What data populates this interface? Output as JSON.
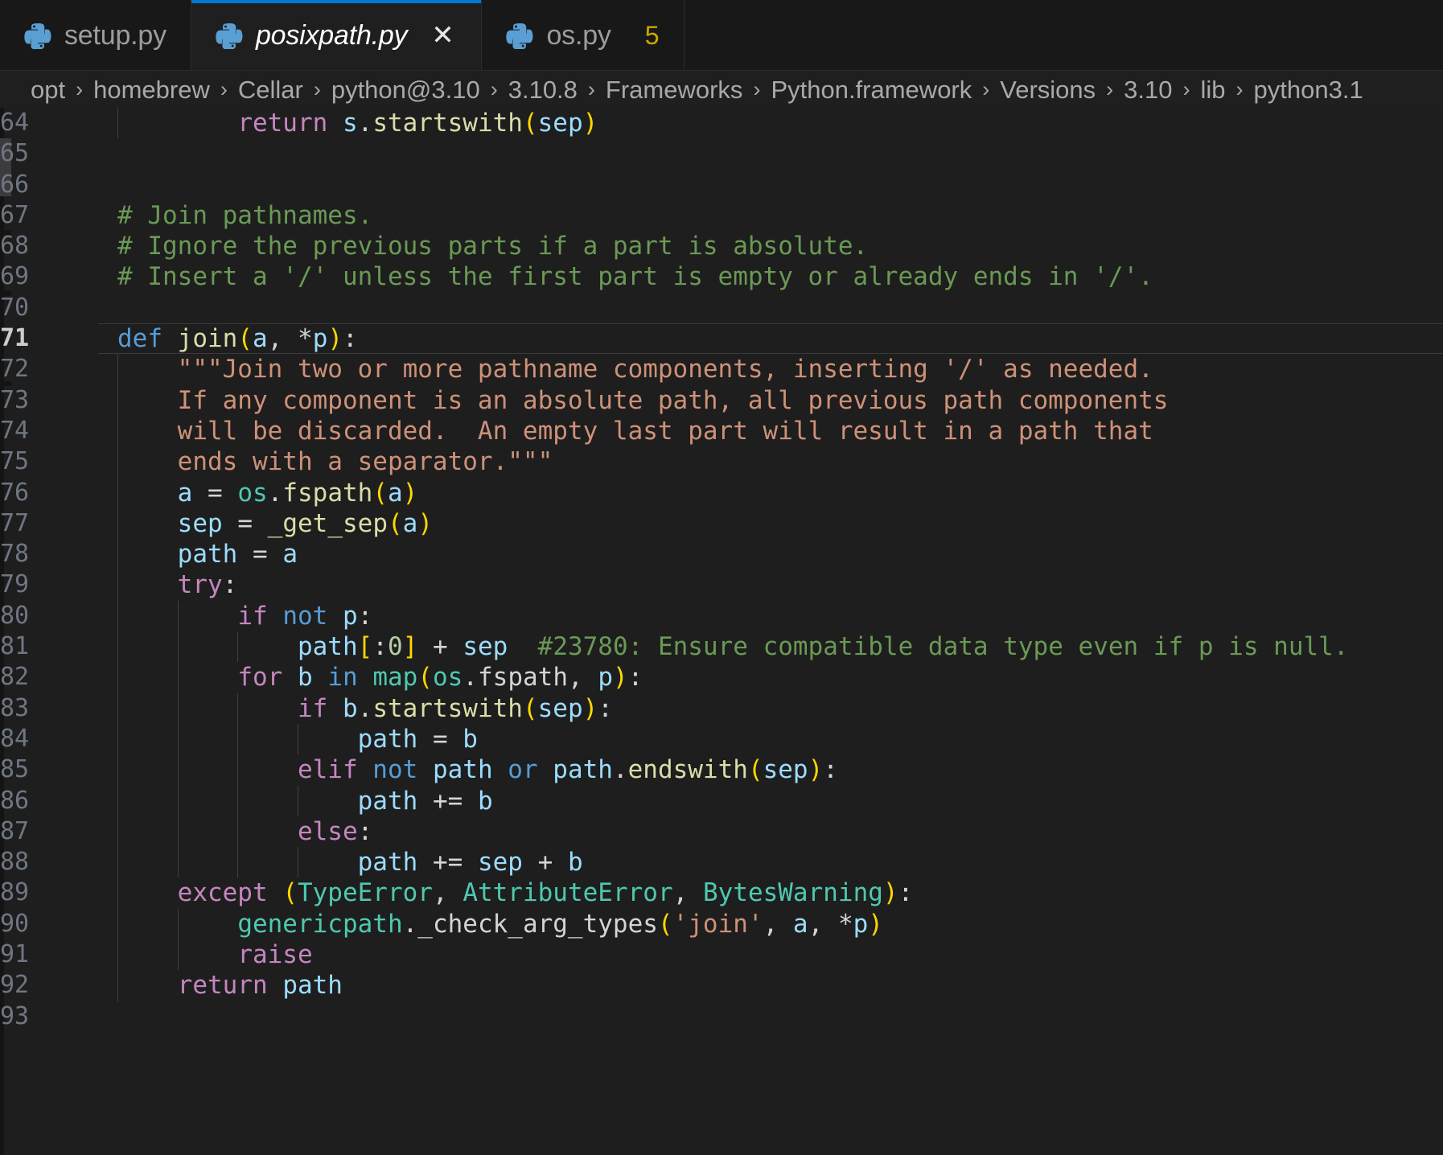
{
  "window": {
    "app": "vscode-editor",
    "background": "#1e1e1e"
  },
  "colors": {
    "accent": "#0078d4",
    "tab_active_bg": "#1f1f1f",
    "tab_inactive_bg": "#181818",
    "editor_bg": "#1e1e1e",
    "keyword_pink": "#c586c0",
    "keyword_blue": "#569cd6",
    "function_yellow": "#dcdcaa",
    "variable_blue": "#9cdcfe",
    "class_teal": "#4ec9b0",
    "string_salmon": "#ce9178",
    "comment_green": "#6a9955",
    "number_green": "#b5cea8",
    "bracket_gold": "#ffd700",
    "warning_amber": "#cca700",
    "linenum_grey": "#6e7681"
  },
  "tabs": [
    {
      "label": "setup.py",
      "icon": "python-file-icon",
      "state": "inactive",
      "badge": "",
      "closable": false,
      "warn": false
    },
    {
      "label": "posixpath.py",
      "icon": "python-file-icon",
      "state": "active",
      "badge": "",
      "closable": true,
      "warn": false
    },
    {
      "label": "os.py",
      "icon": "python-file-icon",
      "state": "inactive",
      "badge": "5",
      "closable": false,
      "warn": true
    }
  ],
  "breadcrumb": {
    "separator": "›",
    "items": [
      "opt",
      "homebrew",
      "Cellar",
      "python@3.10",
      "3.10.8",
      "Frameworks",
      "Python.framework",
      "Versions",
      "3.10",
      "lib",
      "python3.1"
    ]
  },
  "editor": {
    "current_line": 71,
    "first_visible_line": 64,
    "last_visible_line": 93,
    "lines": [
      {
        "n": 64,
        "indent_guides": 1,
        "code": "        return s.startswith(sep)"
      },
      {
        "n": 65,
        "indent_guides": 0,
        "code": ""
      },
      {
        "n": 66,
        "indent_guides": 0,
        "code": ""
      },
      {
        "n": 67,
        "indent_guides": 0,
        "code": "# Join pathnames."
      },
      {
        "n": 68,
        "indent_guides": 0,
        "code": "# Ignore the previous parts if a part is absolute."
      },
      {
        "n": 69,
        "indent_guides": 0,
        "code": "# Insert a '/' unless the first part is empty or already ends in '/'."
      },
      {
        "n": 70,
        "indent_guides": 0,
        "code": ""
      },
      {
        "n": 71,
        "indent_guides": 0,
        "code": "def join(a, *p):"
      },
      {
        "n": 72,
        "indent_guides": 1,
        "code": "    \"\"\"Join two or more pathname components, inserting '/' as needed."
      },
      {
        "n": 73,
        "indent_guides": 1,
        "code": "    If any component is an absolute path, all previous path components"
      },
      {
        "n": 74,
        "indent_guides": 1,
        "code": "    will be discarded.  An empty last part will result in a path that"
      },
      {
        "n": 75,
        "indent_guides": 1,
        "code": "    ends with a separator.\"\"\""
      },
      {
        "n": 76,
        "indent_guides": 1,
        "code": "    a = os.fspath(a)"
      },
      {
        "n": 77,
        "indent_guides": 1,
        "code": "    sep = _get_sep(a)"
      },
      {
        "n": 78,
        "indent_guides": 1,
        "code": "    path = a"
      },
      {
        "n": 79,
        "indent_guides": 1,
        "code": "    try:"
      },
      {
        "n": 80,
        "indent_guides": 2,
        "code": "        if not p:"
      },
      {
        "n": 81,
        "indent_guides": 3,
        "code": "            path[:0] + sep  #23780: Ensure compatible data type even if p is null."
      },
      {
        "n": 82,
        "indent_guides": 2,
        "code": "        for b in map(os.fspath, p):"
      },
      {
        "n": 83,
        "indent_guides": 3,
        "code": "            if b.startswith(sep):"
      },
      {
        "n": 84,
        "indent_guides": 4,
        "code": "                path = b"
      },
      {
        "n": 85,
        "indent_guides": 3,
        "code": "            elif not path or path.endswith(sep):"
      },
      {
        "n": 86,
        "indent_guides": 4,
        "code": "                path += b"
      },
      {
        "n": 87,
        "indent_guides": 3,
        "code": "            else:"
      },
      {
        "n": 88,
        "indent_guides": 4,
        "code": "                path += sep + b"
      },
      {
        "n": 89,
        "indent_guides": 1,
        "code": "    except (TypeError, AttributeError, BytesWarning):"
      },
      {
        "n": 90,
        "indent_guides": 2,
        "code": "        genericpath._check_arg_types('join', a, *p)"
      },
      {
        "n": 91,
        "indent_guides": 2,
        "code": "        raise"
      },
      {
        "n": 92,
        "indent_guides": 1,
        "code": "    return path"
      },
      {
        "n": 93,
        "indent_guides": 0,
        "code": ""
      }
    ]
  }
}
